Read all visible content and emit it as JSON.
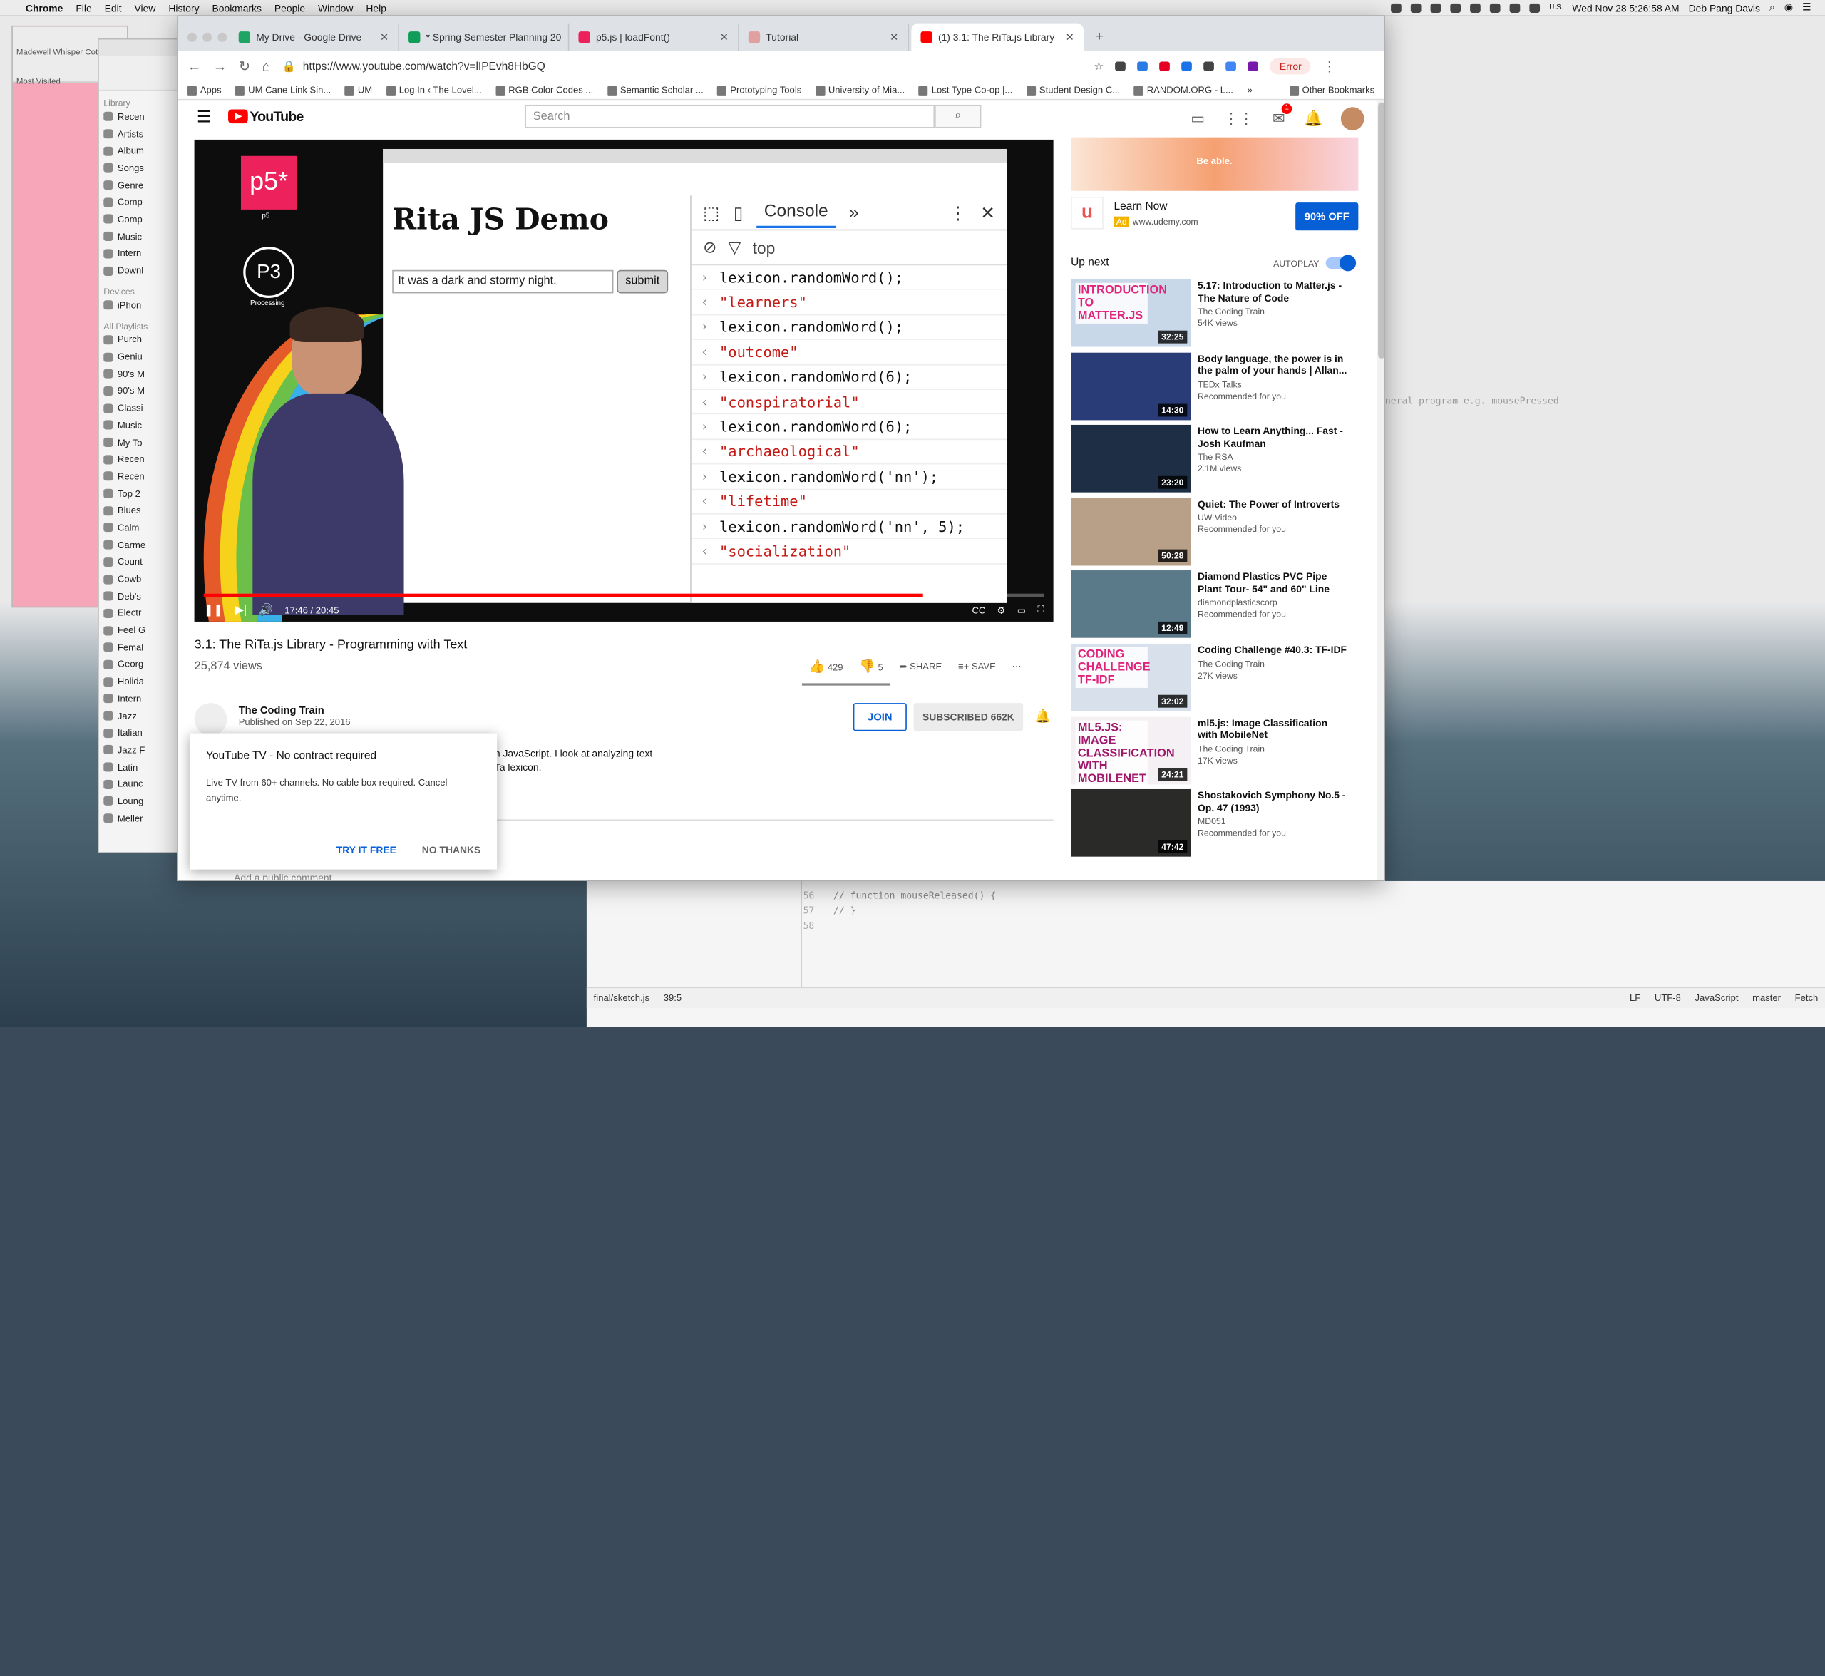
{
  "menubar": {
    "app": "Chrome",
    "items": [
      "File",
      "Edit",
      "View",
      "History",
      "Bookmarks",
      "People",
      "Window",
      "Help"
    ],
    "input_source": "U.S.",
    "clock": "Wed Nov 28  5:26:58 AM",
    "user": "Deb Pang Davis"
  },
  "chrome": {
    "tabs": [
      {
        "title": "My Drive - Google Drive",
        "color": "#1fa463"
      },
      {
        "title": "* Spring Semester Planning 20",
        "color": "#0f9d58"
      },
      {
        "title": "p5.js | loadFont()",
        "color": "#ed225d"
      },
      {
        "title": "Tutorial",
        "color": "#e0a0a0"
      },
      {
        "title": "(1) 3.1: The RiTa.js Library",
        "color": "#ff0000"
      }
    ],
    "new_tab": "+",
    "url": "https://www.youtube.com/watch?v=lIPEvh8HbGQ",
    "error_label": "Error",
    "bookmarks": [
      "Apps",
      "UM Cane Link Sin...",
      "UM",
      "Log In ‹ The Lovel...",
      "RGB Color Codes ...",
      "Semantic Scholar ...",
      "Prototyping Tools",
      "University of Mia...",
      "Lost Type Co-op |...",
      "Student Design C...",
      "RANDOM.ORG - L..."
    ],
    "bookmarks_more": "»",
    "other_bookmarks": "Other Bookmarks"
  },
  "youtube": {
    "logo": "YouTube",
    "search_placeholder": "Search",
    "notification_count": "1",
    "video": {
      "p5_logo": "p5*",
      "p5_caption": "p5",
      "processing_logo": "P3",
      "processing_caption": "Processing",
      "demo_heading": "Rita JS Demo",
      "demo_input": "It was a dark and stormy night.",
      "demo_button": "submit",
      "console_tab": "Console",
      "console_context": "top",
      "console_lines": [
        {
          "kind": "in",
          "text": "lexicon.randomWord();"
        },
        {
          "kind": "out",
          "text": "\"learners\""
        },
        {
          "kind": "in",
          "text": "lexicon.randomWord();"
        },
        {
          "kind": "out",
          "text": "\"outcome\""
        },
        {
          "kind": "in",
          "text": "lexicon.randomWord(6);"
        },
        {
          "kind": "out",
          "text": "\"conspiratorial\""
        },
        {
          "kind": "in",
          "text": "lexicon.randomWord(6);"
        },
        {
          "kind": "out",
          "text": "\"archaeological\""
        },
        {
          "kind": "in",
          "text": "lexicon.randomWord('nn');"
        },
        {
          "kind": "out",
          "text": "\"lifetime\""
        },
        {
          "kind": "in",
          "text": "lexicon.randomWord('nn', 5);"
        },
        {
          "kind": "out",
          "text": "\"socialization\""
        }
      ],
      "time": "17:46 / 20:45",
      "progress_fraction": 0.856
    },
    "title": "3.1: The RiTa.js Library - Programming with Text",
    "views": "25,874 views",
    "likes": "429",
    "dislikes": "5",
    "share": "SHARE",
    "save": "SAVE",
    "channel": "The Coding Train",
    "published": "Published on Sep 22, 2016",
    "join": "JOIN",
    "subscribed": "SUBSCRIBED  662K",
    "description_line1": "n JavaScript.  I look at analyzing text",
    "description_line2": "Ta lexicon.",
    "add_comment": "Add a public comment...",
    "popup": {
      "title": "YouTube TV - No contract required",
      "body": "Live TV from 60+ channels. No cable box required. Cancel anytime.",
      "primary": "TRY IT FREE",
      "secondary": "NO THANKS"
    },
    "ad": {
      "banner_text": "Be able.",
      "logo": "u",
      "title": "Learn Now",
      "badge": "Ad",
      "url": "www.udemy.com",
      "cta": "90% OFF"
    },
    "up_next": "Up next",
    "autoplay": "AUTOPLAY",
    "videos": [
      {
        "title": "5.17: Introduction to Matter.js - The Nature of Code",
        "channel": "The Coding Train",
        "meta": "54K views",
        "duration": "32:25",
        "thumb_text": "INTRODUCTION TO MATTER.JS",
        "bg": "#c8d8e8",
        "tc": "#e0247c"
      },
      {
        "title": "Body language, the power is in the palm of your hands | Allan...",
        "channel": "TEDx Talks",
        "meta": "Recommended for you",
        "duration": "14:30",
        "thumb_text": "",
        "bg": "#2a3c78",
        "tc": "#fff"
      },
      {
        "title": "How to Learn Anything... Fast - Josh Kaufman",
        "channel": "The RSA",
        "meta": "2.1M views",
        "duration": "23:20",
        "thumb_text": "",
        "bg": "#1e2e44",
        "tc": "#fff"
      },
      {
        "title": "Quiet: The Power of Introverts",
        "channel": "UW Video",
        "meta": "Recommended for you",
        "duration": "50:28",
        "thumb_text": "",
        "bg": "#b8a088",
        "tc": "#fff"
      },
      {
        "title": "Diamond Plastics PVC Pipe Plant Tour- 54\" and 60\" Line",
        "channel": "diamondplasticscorp",
        "meta": "Recommended for you",
        "duration": "12:49",
        "thumb_text": "",
        "bg": "#5a7a8a",
        "tc": "#fff"
      },
      {
        "title": "Coding Challenge #40.3: TF-IDF",
        "channel": "The Coding Train",
        "meta": "27K views",
        "duration": "32:02",
        "thumb_text": "CODING CHALLENGE TF-IDF",
        "bg": "#d8e0ec",
        "tc": "#e0247c"
      },
      {
        "title": "ml5.js: Image Classification with MobileNet",
        "channel": "The Coding Train",
        "meta": "17K views",
        "duration": "24:21",
        "thumb_text": "ML5.JS: IMAGE CLASSIFICATION WITH MOBILENET",
        "bg": "#f4f0f4",
        "tc": "#a0186c"
      },
      {
        "title": "Shostakovich Symphony No.5 - Op. 47 (1993)",
        "channel": "MD051",
        "meta": "Recommended for you",
        "duration": "47:42",
        "thumb_text": "",
        "bg": "#2a2a28",
        "tc": "#fff"
      }
    ]
  },
  "itunes": {
    "library_header": "Library",
    "library": [
      "Recen",
      "Artists",
      "Album",
      "Songs",
      "Genre",
      "Comp",
      "Comp",
      "Music",
      "Intern",
      "Downl"
    ],
    "devices_header": "Devices",
    "devices": [
      "iPhon"
    ],
    "playlists_header": "All Playlists",
    "playlists": [
      "Purch",
      "Geniu",
      "90's M",
      "90's M",
      "Classi",
      "Music",
      "My To",
      "Recen",
      "Recen",
      "Top 2",
      "Blues",
      "Calm",
      "Carme",
      "Count",
      "Cowb",
      "Deb's",
      "Electr",
      "Feel G",
      "Femal",
      "Georg",
      "Holida",
      "Intern",
      "Jazz",
      "Italian",
      "Jazz F",
      "Latin",
      "Launc",
      "Loung",
      "Meller"
    ]
  },
  "firefox": {
    "tab_title": "Madewell Whisper Cot",
    "most_visited": "Most Visited"
  },
  "editor": {
    "lines": [
      {
        "n": "56",
        "code": "// function mouseReleased() {"
      },
      {
        "n": "57",
        "code": "// }"
      },
      {
        "n": "58",
        "code": ""
      }
    ],
    "file": "final/sketch.js",
    "pos": "39:5",
    "lf": "LF",
    "enc": "UTF-8",
    "lang": "JavaScript",
    "branch": "master",
    "fetch": "Fetch",
    "side_comment": "neral program e.g. mousePressed"
  }
}
